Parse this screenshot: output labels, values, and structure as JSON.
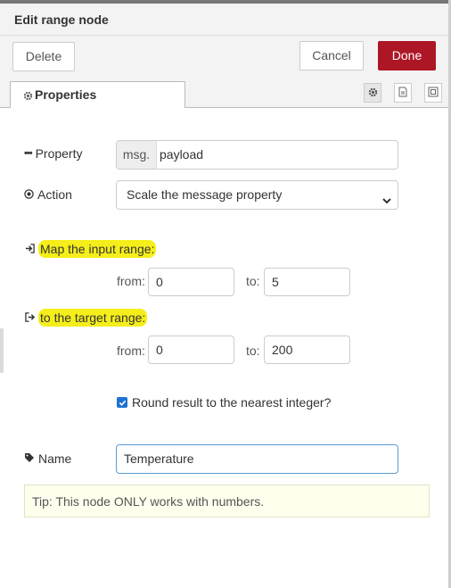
{
  "dialog": {
    "title": "Edit range node"
  },
  "buttons": {
    "delete": "Delete",
    "cancel": "Cancel",
    "done": "Done"
  },
  "tabs": {
    "properties": "Properties"
  },
  "form": {
    "property_label": "Property",
    "property_prefix": "msg.",
    "property_value": "payload",
    "action_label": "Action",
    "action_value": "Scale the message property",
    "input_range_label": "Map the input range:",
    "target_range_label": "to the target range:",
    "from_label": "from:",
    "to_label": "to:",
    "input_from": "0",
    "input_to": "5",
    "target_from": "0",
    "target_to": "200",
    "round_label": "Round result to the nearest integer?",
    "round_checked": true,
    "name_label": "Name",
    "name_value": "Temperature",
    "tip": "Tip: This node ONLY works with numbers."
  },
  "colors": {
    "done_button": "#ad1625",
    "highlight": "#f5ee1a",
    "checkbox": "#1e72d1"
  },
  "icons": [
    "gear-icon",
    "book-icon",
    "frame-icon",
    "ellipsis-icon",
    "target-icon",
    "sign-in-icon",
    "sign-out-icon",
    "tag-icon",
    "chevron-down-icon",
    "check-icon"
  ]
}
